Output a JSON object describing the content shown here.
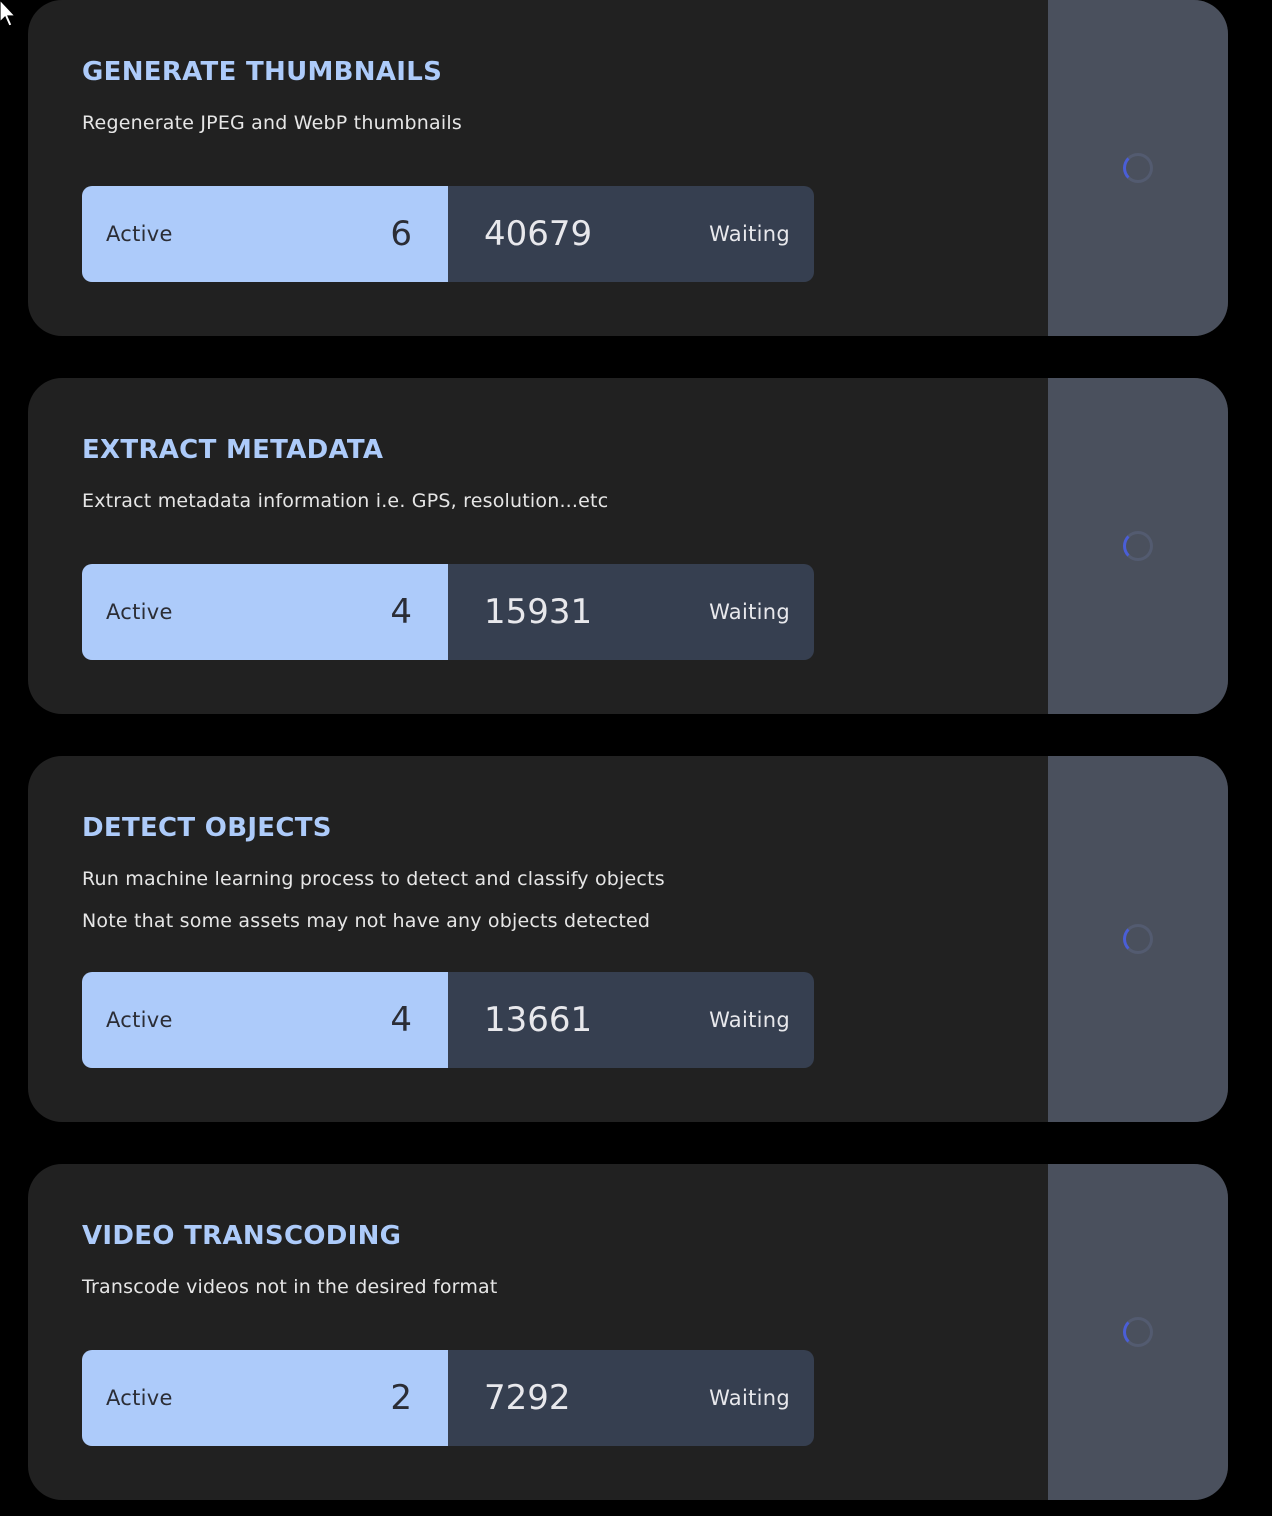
{
  "jobs": [
    {
      "title": "GENERATE THUMBNAILS",
      "description": [
        "Regenerate JPEG and WebP thumbnails"
      ],
      "active_label": "Active",
      "active_count": "6",
      "waiting_count": "40679",
      "waiting_label": "Waiting"
    },
    {
      "title": "EXTRACT METADATA",
      "description": [
        "Extract metadata information i.e. GPS, resolution...etc"
      ],
      "active_label": "Active",
      "active_count": "4",
      "waiting_count": "15931",
      "waiting_label": "Waiting"
    },
    {
      "title": "DETECT OBJECTS",
      "description": [
        "Run machine learning process to detect and classify objects",
        "Note that some assets may not have any objects detected"
      ],
      "active_label": "Active",
      "active_count": "4",
      "waiting_count": "13661",
      "waiting_label": "Waiting"
    },
    {
      "title": "VIDEO TRANSCODING",
      "description": [
        "Transcode videos not in the desired format"
      ],
      "active_label": "Active",
      "active_count": "2",
      "waiting_count": "7292",
      "waiting_label": "Waiting"
    }
  ],
  "icons": {
    "spinner": "loading-spinner-icon",
    "cursor": "mouse-cursor-icon"
  },
  "colors": {
    "page_background": "#000000",
    "card_background": "#212121",
    "title": "#adcbfa",
    "active_background": "#adcbfa",
    "waiting_background": "#363f50",
    "side_panel": "#4a505d",
    "spinner_accent": "#4a5ed6"
  }
}
